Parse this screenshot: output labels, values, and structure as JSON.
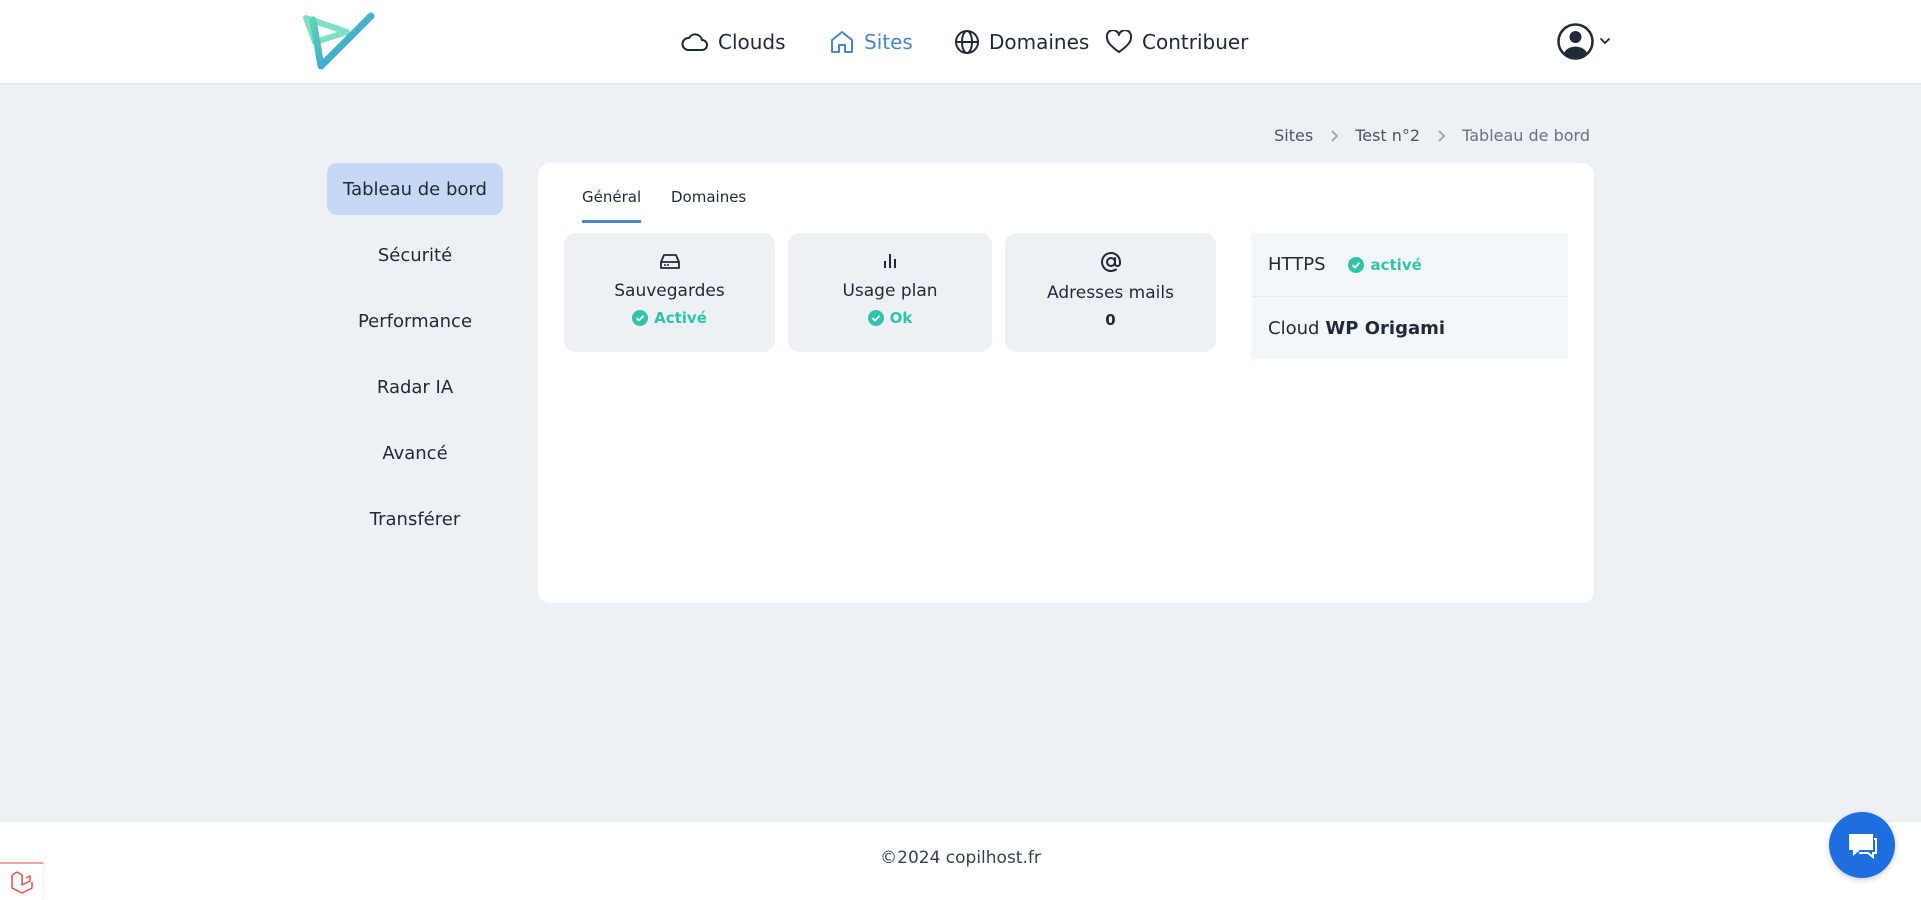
{
  "header": {
    "nav": [
      {
        "label": "Clouds",
        "icon": "cloud-icon",
        "active": false
      },
      {
        "label": "Sites",
        "icon": "home-icon",
        "active": true
      },
      {
        "label": "Domaines",
        "icon": "globe-icon",
        "active": false
      },
      {
        "label": "Contribuer",
        "icon": "heart-icon",
        "active": false
      }
    ],
    "accent_color": "#4a86cf"
  },
  "breadcrumb": [
    "Sites",
    "Test n°2",
    "Tableau de bord"
  ],
  "sidebar": {
    "items": [
      {
        "label": "Tableau de bord",
        "active": true
      },
      {
        "label": "Sécurité"
      },
      {
        "label": "Performance"
      },
      {
        "label": "Radar IA"
      },
      {
        "label": "Avancé"
      },
      {
        "label": "Transférer"
      }
    ]
  },
  "main": {
    "tabs": [
      {
        "label": "Général",
        "active": true
      },
      {
        "label": "Domaines"
      }
    ],
    "stats": [
      {
        "label": "Sauvegardes",
        "status": "Activé",
        "icon": "hard-drive-icon"
      },
      {
        "label": "Usage plan",
        "status": "Ok",
        "icon": "bar-chart-icon"
      },
      {
        "label": "Adresses mails",
        "count": "0",
        "icon": "at-sign-icon"
      }
    ],
    "info": {
      "https_label": "HTTPS",
      "https_status": "activé",
      "cloud_label": "Cloud",
      "cloud_name": "WP Origami"
    },
    "status_color": "#2fc4a8"
  },
  "footer": {
    "text": "©2024 copilhost.fr"
  }
}
